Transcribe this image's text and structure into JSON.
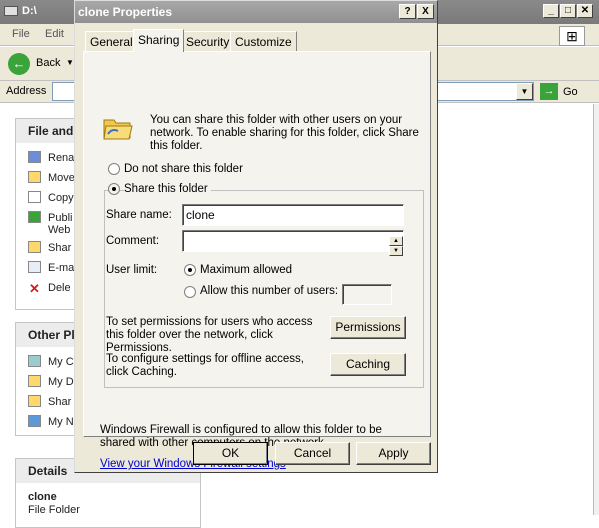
{
  "explorer": {
    "title": "D:\\",
    "menu": [
      "File",
      "Edit"
    ],
    "back_label": "Back",
    "address_label": "Address",
    "go_label": "Go",
    "file_tasks": {
      "header": "File and",
      "items": [
        "Rena",
        "Move",
        "Copy",
        "Publi",
        "Web",
        "Shar",
        "E-ma",
        "Dele"
      ]
    },
    "other_places": {
      "header": "Other Pl",
      "items": [
        "My C",
        "My D",
        "Shar",
        "My N"
      ]
    },
    "details": {
      "header": "Details",
      "name": "clone",
      "type": "File Folder"
    }
  },
  "dialog": {
    "title": "clone Properties",
    "help_button": "?",
    "close_button": "X",
    "tabs": [
      "General",
      "Sharing",
      "Security",
      "Customize"
    ],
    "active_tab": "Sharing",
    "intro_text": "You can share this folder with other users on your network.  To enable sharing for this folder, click Share this folder.",
    "option_not_share": "Do not share this folder",
    "option_share": "Share this folder",
    "share_name_label": "Share name:",
    "share_name_value": "clone",
    "comment_label": "Comment:",
    "comment_value": "",
    "user_limit_label": "User limit:",
    "limit_max": "Maximum allowed",
    "limit_allow": "Allow this number of users:",
    "permissions_text": "To set permissions for users who access this folder over the network, click Permissions.",
    "permissions_button": "Permissions",
    "caching_text": "To configure settings for offline access, click Caching.",
    "caching_button": "Caching",
    "firewall_text": "Windows Firewall is configured to allow this folder to be shared with other computers on the network.",
    "firewall_link": "View your Windows Firewall settings",
    "ok_button": "OK",
    "cancel_button": "Cancel",
    "apply_button": "Apply"
  }
}
